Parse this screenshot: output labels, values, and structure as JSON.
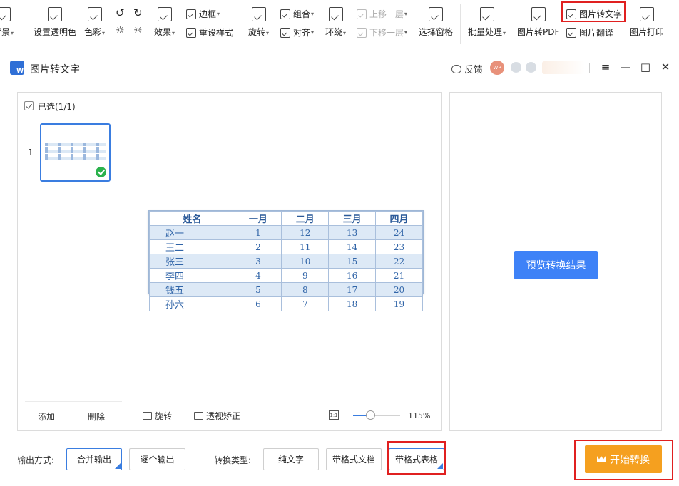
{
  "ribbon": {
    "background_partial": "背景",
    "set_transparent": "设置透明色",
    "color": "色彩",
    "effects": "效果",
    "border": "边框",
    "reset_style": "重设样式",
    "rotate": "旋转",
    "group": "组合",
    "align": "对齐",
    "wrap": "环绕",
    "bring_forward": "上移一层",
    "send_backward": "下移一层",
    "selection_pane": "选择窗格",
    "batch_process": "批量处理",
    "image_to_pdf": "图片转PDF",
    "image_to_text": "图片转文字",
    "image_translate": "图片翻译",
    "image_print": "图片打印"
  },
  "window": {
    "title": "图片转文字",
    "feedback": "反馈",
    "avatar_text": "WP"
  },
  "left_panel": {
    "selected_label": "已选(1/1)",
    "thumb_index": "1",
    "add": "添加",
    "delete": "删除",
    "rotate": "旋转",
    "perspective_correct": "透视矫正",
    "fit_label": "1:1",
    "zoom": "115%",
    "zoom_percent": 115
  },
  "preview_table": {
    "headers": [
      "姓名",
      "一月",
      "二月",
      "三月",
      "四月"
    ],
    "rows": [
      [
        "赵一",
        "1",
        "12",
        "13",
        "24"
      ],
      [
        "王二",
        "2",
        "11",
        "14",
        "23"
      ],
      [
        "张三",
        "3",
        "10",
        "15",
        "22"
      ],
      [
        "李四",
        "4",
        "9",
        "16",
        "21"
      ],
      [
        "钱五",
        "5",
        "8",
        "17",
        "20"
      ],
      [
        "孙六",
        "6",
        "7",
        "18",
        "19"
      ]
    ]
  },
  "right_panel": {
    "preview_button": "预览转换结果"
  },
  "bottom": {
    "output_label": "输出方式:",
    "merge_output": "合并输出",
    "single_output": "逐个输出",
    "type_label": "转换类型:",
    "plain_text": "纯文字",
    "formatted_doc": "带格式文档",
    "formatted_table": "带格式表格",
    "start_button": "开始转换"
  },
  "colors": {
    "accent_blue": "#3e82f7",
    "start_orange": "#f5a01f",
    "highlight_red": "#e02020",
    "table_stripe": "#dde9f6"
  }
}
